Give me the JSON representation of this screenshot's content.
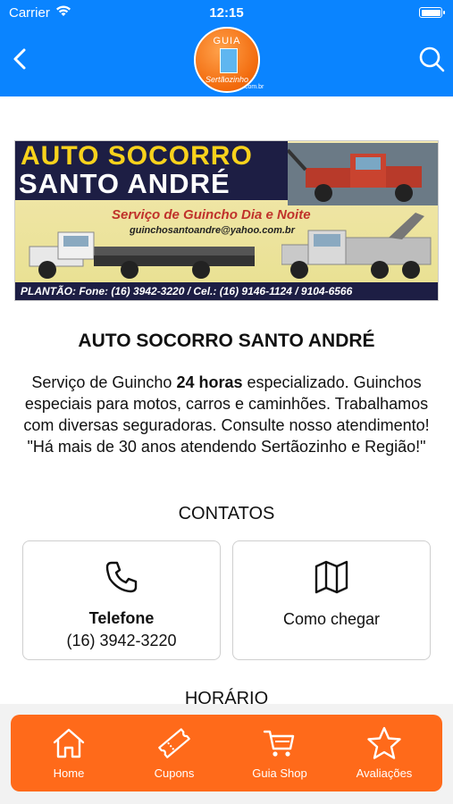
{
  "status_bar": {
    "carrier": "Carrier",
    "time": "12:15"
  },
  "header": {
    "logo": {
      "line1": "GUIA",
      "line2": "Sertãozinho",
      "domain": ".com.br"
    },
    "back_icon": "chevron-left-icon",
    "search_icon": "search-icon"
  },
  "banner": {
    "line1": "AUTO SOCORRO",
    "line2": "SANTO ANDRÉ",
    "tagline": "Serviço de Guincho Dia e Noite",
    "email": "guinchosantoandre@yahoo.com.br",
    "contact": "PLANTÃO: Fone: (16) 3942-3220 / Cel.: (16) 9146-1124 / 9104-6566"
  },
  "business": {
    "name": "AUTO SOCORRO SANTO ANDRÉ",
    "desc_part1": "Serviço de Guincho ",
    "desc_bold": "24 horas",
    "desc_part2": " especializado. Guinchos especiais para motos, carros e caminhões. Trabalhamos com diversas seguradoras. Consulte nosso atendimento! \"Há mais de 30 anos atendendo Sertãozinho e Região!\""
  },
  "contacts": {
    "heading": "CONTATOS",
    "phone": {
      "label": "Telefone",
      "value": "(16) 3942-3220",
      "icon": "phone-icon"
    },
    "directions": {
      "label": "Como chegar",
      "icon": "map-icon"
    }
  },
  "hours": {
    "heading": "HORÁRIO"
  },
  "colors": {
    "header": "#0a84ff",
    "tabbar": "#ff6a1a"
  },
  "tabs": [
    {
      "label": "Home",
      "icon": "home-icon"
    },
    {
      "label": "Cupons",
      "icon": "ticket-icon"
    },
    {
      "label": "Guia Shop",
      "icon": "cart-icon"
    },
    {
      "label": "Avaliações",
      "icon": "star-icon"
    }
  ]
}
